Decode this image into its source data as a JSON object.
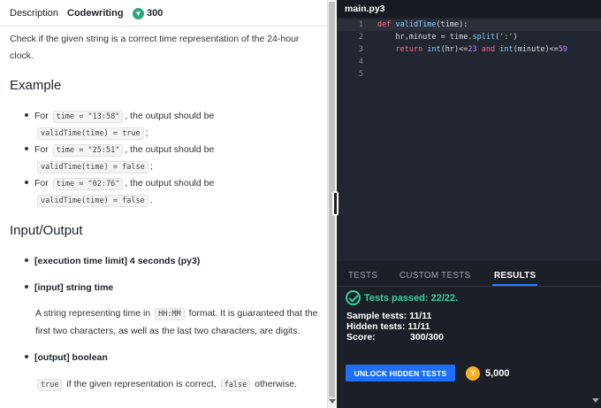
{
  "header": {
    "tab_description": "Description",
    "tab_codewriting": "Codewriting",
    "score": "300"
  },
  "description": "Check if the given string is a correct time representation of the 24-hour clock.",
  "example": {
    "heading": "Example",
    "items": [
      {
        "prefix": "For",
        "input": "time = \"13:58\"",
        "middle": ", the output should be",
        "call": "validTime(time) = true",
        "end": ";"
      },
      {
        "prefix": "For",
        "input": "time = \"25:51\"",
        "middle": ", the output should be",
        "call": "validTime(time) = false",
        "end": ";"
      },
      {
        "prefix": "For",
        "input": "time = \"02:76\"",
        "middle": ", the output should be",
        "call": "validTime(time) = false",
        "end": "."
      }
    ]
  },
  "io": {
    "heading": "Input/Output",
    "time_limit": "[execution time limit] 4 seconds (py3)",
    "input_label": "[input] string time",
    "input_desc_1": "A string representing time in",
    "input_code": "HH:MM",
    "input_desc_2": "format. It is guaranteed that the first two characters, as well as the last two characters, are digits.",
    "output_label": "[output] boolean",
    "output_code_true": "true",
    "output_desc_1": "if the given representation is correct,",
    "output_code_false": "false",
    "output_desc_2": "otherwise."
  },
  "editor": {
    "file_name": "main.py3",
    "line_numbers": [
      "1",
      "2",
      "3",
      "4",
      "5"
    ]
  },
  "results": {
    "tabs": [
      "TESTS",
      "CUSTOM TESTS",
      "RESULTS"
    ],
    "passed": "Tests passed: 22/22.",
    "sample_label": "Sample tests: 11/11",
    "hidden_label": "Hidden tests: 11/11",
    "score_label": "Score:",
    "score_value": "300/300",
    "unlock_button": "UNLOCK HIDDEN TESTS",
    "coins": "5,000"
  },
  "colors": {
    "accent_blue": "#1f6fff",
    "success_green": "#35d0a0",
    "coin_green": "#2aa87f",
    "coin_gold": "#ffb020",
    "editor_bg": "#222630"
  }
}
